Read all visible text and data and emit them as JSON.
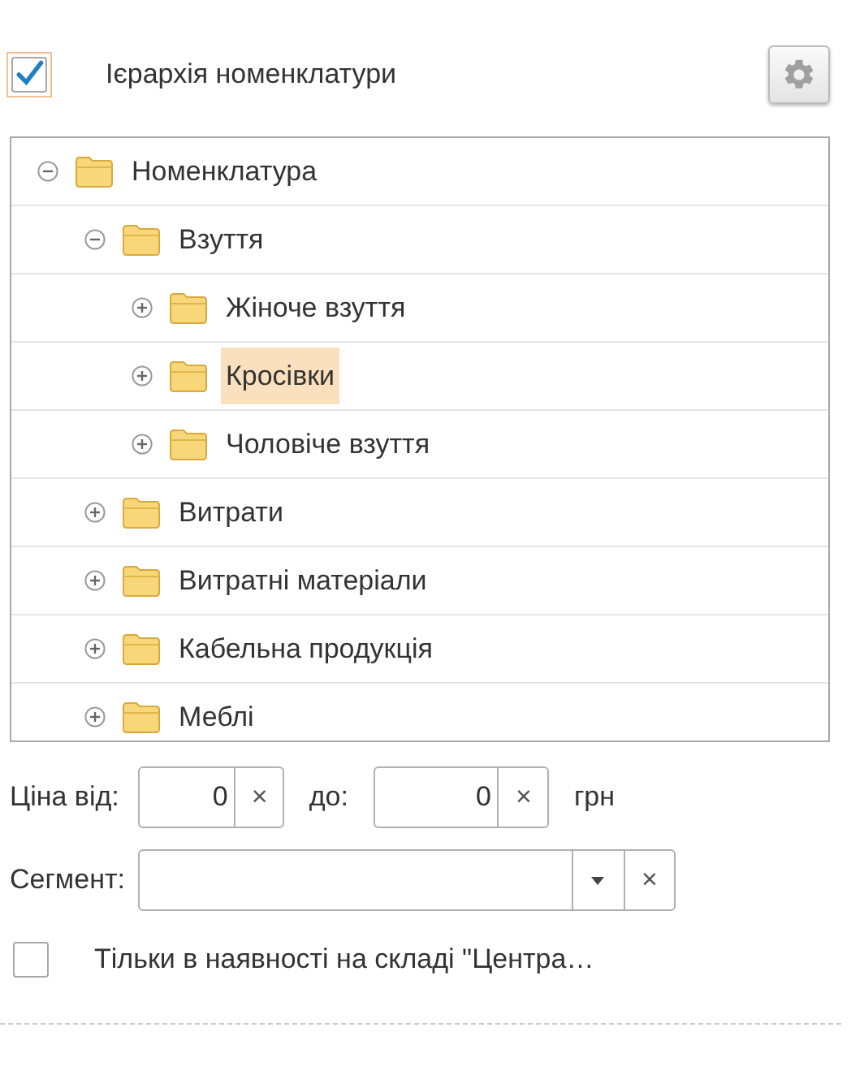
{
  "hierarchy": {
    "label": "Ієрархія номенклатури",
    "checked": true
  },
  "tree": [
    {
      "label": "Номенклатура",
      "expanded": true,
      "selected": false,
      "children": [
        {
          "label": "Взуття",
          "expanded": true,
          "selected": false,
          "children": [
            {
              "label": "Жіноче взуття",
              "expanded": false,
              "selected": false
            },
            {
              "label": "Кросівки",
              "expanded": false,
              "selected": true
            },
            {
              "label": "Чоловіче взуття",
              "expanded": false,
              "selected": false
            }
          ]
        },
        {
          "label": "Витрати",
          "expanded": false,
          "selected": false
        },
        {
          "label": "Витратні матеріали",
          "expanded": false,
          "selected": false
        },
        {
          "label": "Кабельна продукція",
          "expanded": false,
          "selected": false
        },
        {
          "label": "Меблі",
          "expanded": false,
          "selected": false
        }
      ]
    }
  ],
  "price": {
    "from_label": "Ціна від:",
    "from_value": "0",
    "clear_from": "×",
    "to_label": "до:",
    "to_value": "0",
    "clear_to": "×",
    "currency": "грн"
  },
  "segment": {
    "label": "Сегмент:",
    "clear": "×"
  },
  "in_stock": {
    "label": "Тільки в наявності на складі \"Центра…",
    "checked": false
  }
}
